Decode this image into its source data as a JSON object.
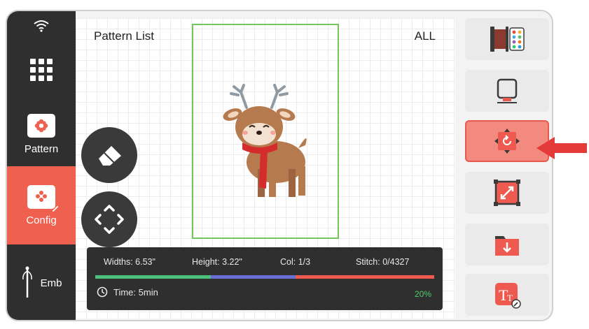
{
  "sidebar": {
    "items": [
      {
        "label": "Pattern"
      },
      {
        "label": "Config"
      },
      {
        "label": "Emb"
      }
    ]
  },
  "main": {
    "title": "Pattern List",
    "filter": "ALL"
  },
  "info": {
    "widths": "Widths: 6.53\"",
    "height": "Height: 3.22\"",
    "col": "Col: 1/3",
    "stitch": "Stitch: 0/4327",
    "time": "Time: 5min",
    "percent": "20%",
    "progress_segments": [
      {
        "color": "#4cc07a",
        "fraction": 0.34
      },
      {
        "color": "#6a6fd8",
        "fraction": 0.25
      },
      {
        "color": "#ee5a4f",
        "fraction": 0.41
      }
    ]
  },
  "colors": {
    "accent": "#f0604f",
    "hoop": "#74c65b",
    "sidebar": "#2f2f2f"
  },
  "toolbar": {
    "icons": [
      "thread-color-icon",
      "hoop-icon",
      "rotate-icon",
      "resize-icon",
      "import-folder-icon",
      "text-edit-icon"
    ],
    "active": "rotate-icon"
  }
}
